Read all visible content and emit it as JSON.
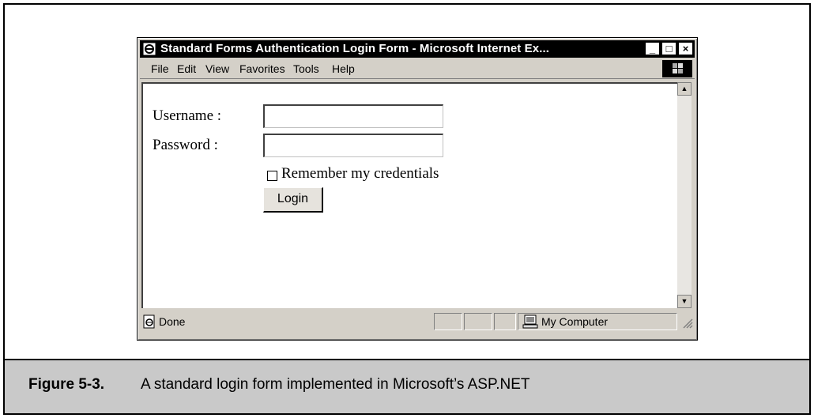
{
  "window": {
    "title": "Standard Forms Authentication Login Form - Microsoft Internet Ex...",
    "controls": {
      "minimize": "_",
      "maximize": "□",
      "close": "×"
    }
  },
  "menu": [
    {
      "label": "File"
    },
    {
      "label": "Edit"
    },
    {
      "label": "View"
    },
    {
      "label": "Favorites"
    },
    {
      "label": "Tools"
    },
    {
      "label": "Help"
    }
  ],
  "form": {
    "username_label": "Username :",
    "username_value": "",
    "password_label": "Password :",
    "password_value": "",
    "remember_label": "Remember my credentials",
    "remember_checked": false,
    "login_label": "Login"
  },
  "status": {
    "text": "Done",
    "zone": "My Computer"
  },
  "figure": {
    "label": "Figure 5-3.",
    "caption": "A standard login form implemented in Microsoft’s ASP.NET"
  },
  "icons": [
    "ie-icon",
    "windows-logo-icon",
    "done-page-icon",
    "my-computer-icon",
    "resize-grip-icon"
  ]
}
